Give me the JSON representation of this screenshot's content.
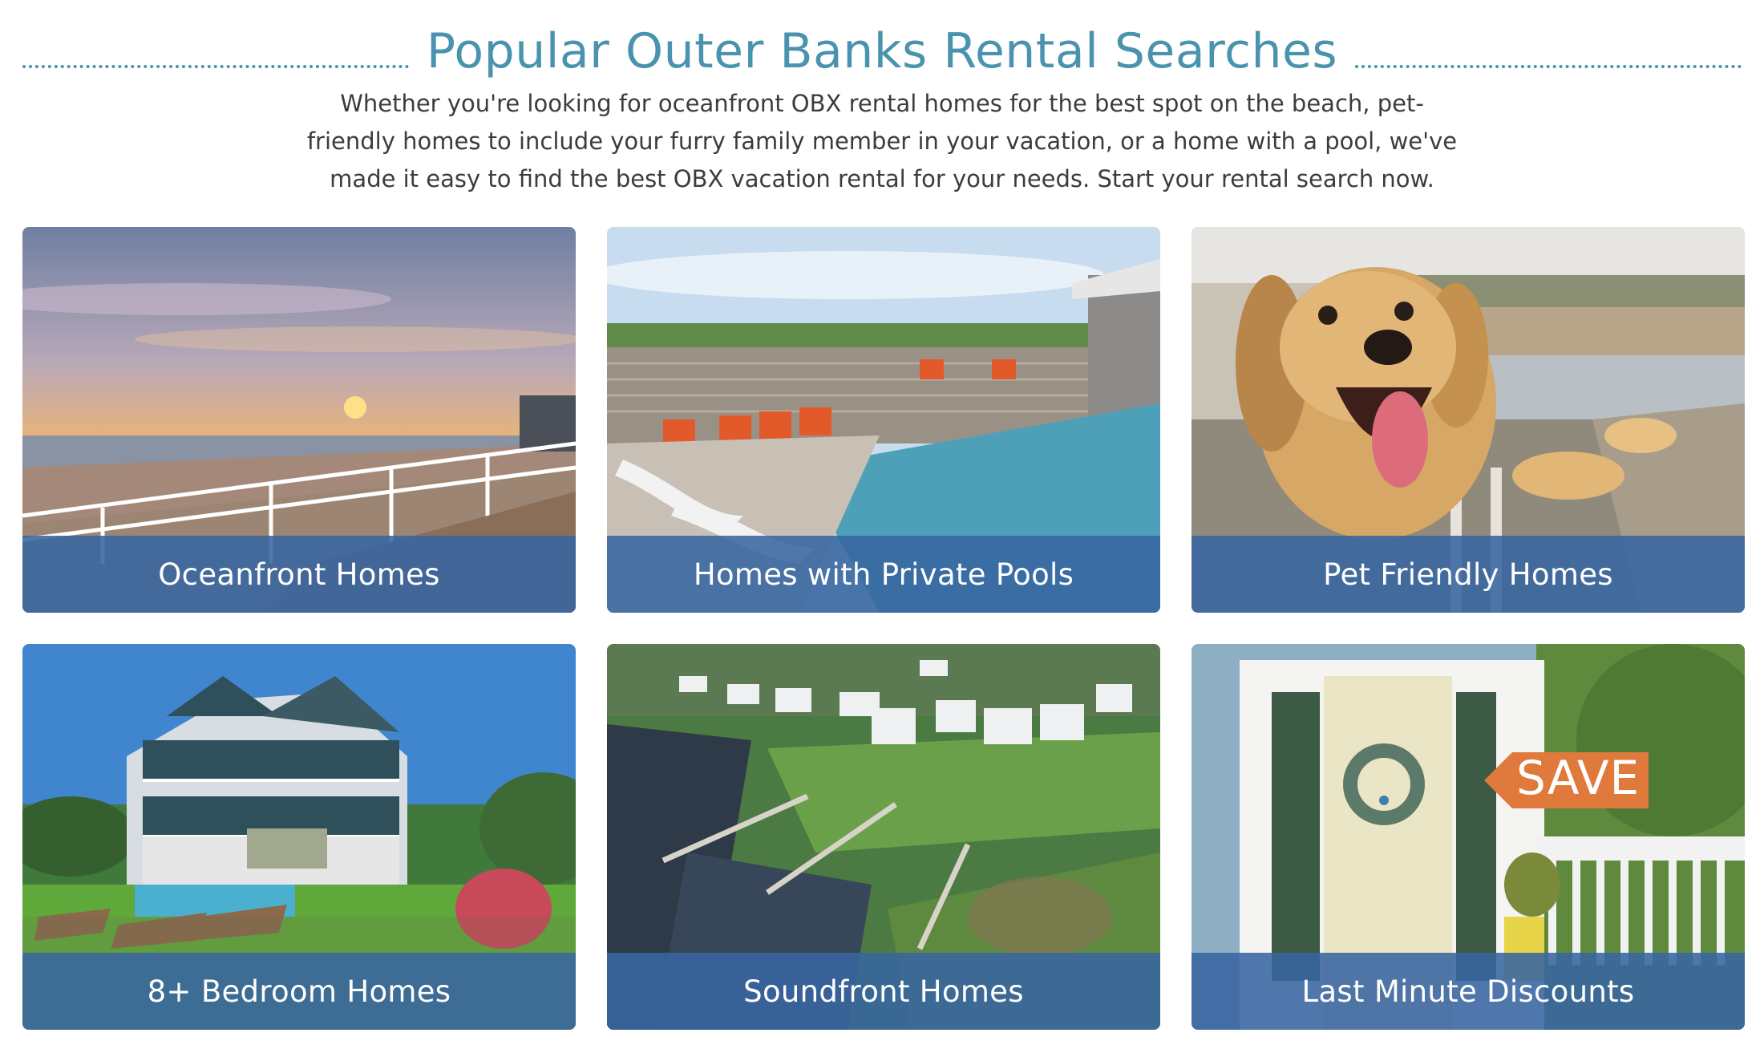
{
  "section": {
    "title": "Popular Outer Banks Rental Searches",
    "intro": "Whether you're looking for oceanfront OBX rental homes for the best spot on the beach, pet-friendly homes to include your furry family member in your vacation, or a home with a pool, we've made it easy to find the best OBX vacation rental for your needs. Start your rental search now."
  },
  "cards": [
    {
      "label": "Oceanfront Homes",
      "image": "sunset-beach-deck-photo"
    },
    {
      "label": "Homes with Private Pools",
      "image": "private-pool-photo"
    },
    {
      "label": "Pet Friendly Homes",
      "image": "golden-retriever-photo"
    },
    {
      "label": "8+ Bedroom Homes",
      "image": "large-beach-house-photo"
    },
    {
      "label": "Soundfront Homes",
      "image": "soundfront-aerial-photo"
    },
    {
      "label": "Last Minute Discounts",
      "image": "front-door-save-photo",
      "badge": "SAVE"
    }
  ],
  "colors": {
    "accent": "#4a93ae",
    "caption_bg": "#3865a0",
    "badge": "#e07a3c"
  }
}
